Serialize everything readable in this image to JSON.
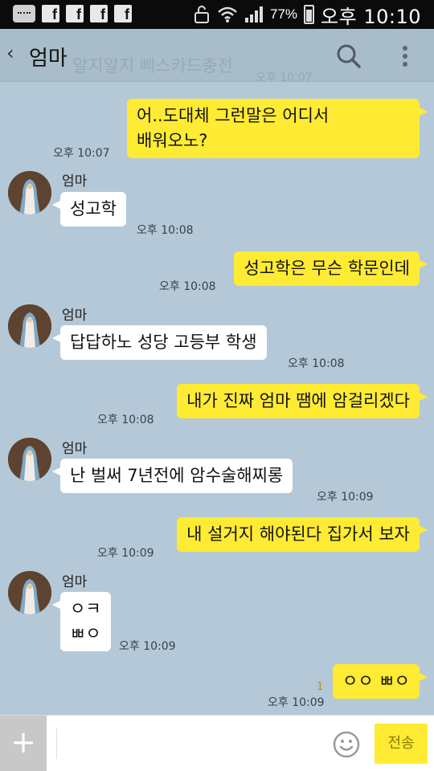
{
  "status_bar": {
    "battery": "77%",
    "time": "오후 10:10",
    "notification_icons": [
      "message-icon",
      "facebook-icon",
      "facebook-icon",
      "facebook-icon",
      "facebook-icon"
    ],
    "fb_letter": "f"
  },
  "header": {
    "title": "엄마",
    "ghost_text": "알지알지 삐스카드충전",
    "ghost_time": "오후 10:07"
  },
  "messages": [
    {
      "side": "out",
      "lines": [
        "어..도대체 그런말은 어디서",
        "배워오노?"
      ],
      "time": "오후 10:07"
    },
    {
      "side": "in",
      "sender": "엄마",
      "lines": [
        "성고학"
      ],
      "time": "오후 10:08"
    },
    {
      "side": "out",
      "lines": [
        "성고학은 무슨 학문인데"
      ],
      "time": "오후 10:08"
    },
    {
      "side": "in",
      "sender": "엄마",
      "lines": [
        "답답하노 성당 고등부 학생"
      ],
      "time": "오후 10:08"
    },
    {
      "side": "out",
      "lines": [
        "내가 진짜 엄마 땜에 암걸리겠다"
      ],
      "time": "오후 10:08"
    },
    {
      "side": "in",
      "sender": "엄마",
      "lines": [
        "난 벌써 7년전에 암수술해찌롱"
      ],
      "time": "오후 10:09"
    },
    {
      "side": "out",
      "lines": [
        "내 설거지 해야된다 집가서 보자"
      ],
      "time": "오후 10:09"
    },
    {
      "side": "in",
      "sender": "엄마",
      "lines": [
        "ㅇㅋ",
        "ㅃㅇ"
      ],
      "time": "오후 10:09"
    },
    {
      "side": "out",
      "lines": [
        "ㅇㅇ ㅃㅇ"
      ],
      "time": "오후 10:09",
      "unread": "1"
    }
  ],
  "input": {
    "send_label": "전송"
  }
}
